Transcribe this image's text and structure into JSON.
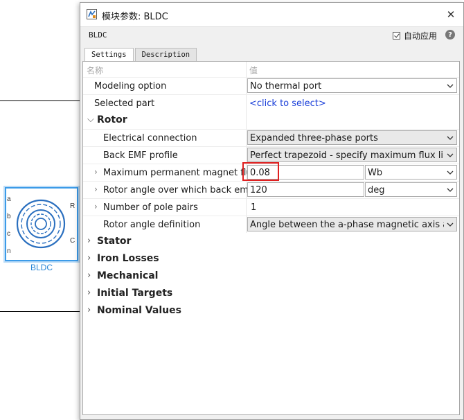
{
  "block": {
    "label": "BLDC",
    "ports_left": [
      "a",
      "b",
      "c",
      "n"
    ],
    "ports_right": [
      "R",
      "C"
    ]
  },
  "dialog": {
    "title": "模块参数: BLDC",
    "block_name": "BLDC",
    "auto_apply_label": "自动应用",
    "auto_apply_checked": true,
    "help_symbol": "?",
    "close_symbol": "✕",
    "tabs": [
      {
        "label": "Settings",
        "active": true
      },
      {
        "label": "Description",
        "active": false
      }
    ],
    "table_header": {
      "name": "名称",
      "value": "值"
    }
  },
  "params": {
    "modeling_option": {
      "label": "Modeling option",
      "value": "No thermal port"
    },
    "selected_part": {
      "label": "Selected part",
      "value": "<click to select>"
    },
    "rotor_section": "Rotor",
    "electrical_connection": {
      "label": "Electrical connection",
      "value": "Expanded three-phase ports"
    },
    "back_emf_profile": {
      "label": "Back EMF profile",
      "value": "Perfect trapezoid - specify maximum flux linkage"
    },
    "max_pm_flux": {
      "label": "Maximum permanent magnet flu...",
      "value": "0.08",
      "unit": "Wb"
    },
    "rotor_angle_back_emf": {
      "label": "Rotor angle over which back em...",
      "value": "120",
      "unit": "deg"
    },
    "pole_pairs": {
      "label": "Number of pole pairs",
      "value": "1"
    },
    "rotor_angle_def": {
      "label": "Rotor angle definition",
      "value": "Angle between the a-phase magnetic axis and the"
    }
  },
  "sections": [
    "Stator",
    "Iron Losses",
    "Mechanical",
    "Initial Targets",
    "Nominal Values"
  ],
  "colors": {
    "accent_block": "#3c9be8",
    "link": "#1a3fd9",
    "highlight": "#e02020"
  }
}
